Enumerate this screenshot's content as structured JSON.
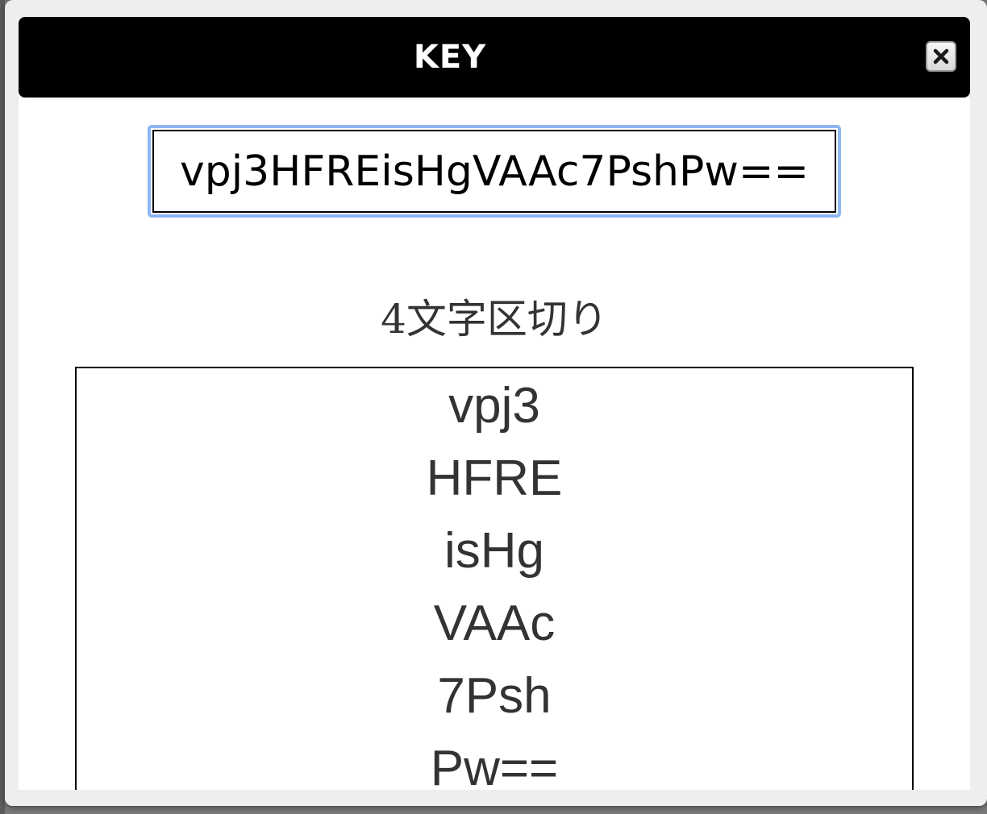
{
  "dialog": {
    "title": "KEY",
    "close_icon": "close-x-icon"
  },
  "key_field": {
    "value": "vpj3HFREisHgVAAc7PshPw=="
  },
  "chunks": {
    "heading": "4文字区切り",
    "items": [
      "vpj3",
      "HFRE",
      "isHg",
      "VAAc",
      "7Psh",
      "Pw=="
    ]
  },
  "colors": {
    "titlebar": "#000000",
    "focus_ring": "#8fb6f2",
    "text": "#333333"
  }
}
